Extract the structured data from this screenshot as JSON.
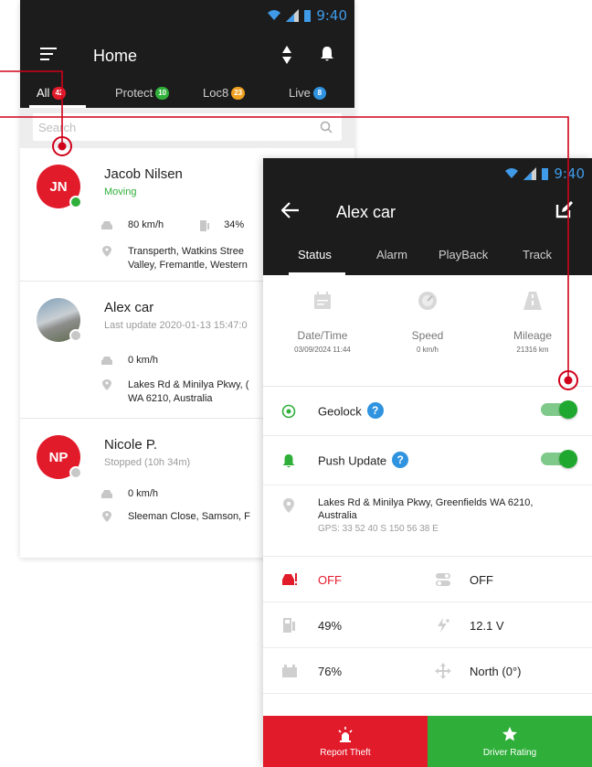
{
  "colors": {
    "dark_bar": "#1c1c1c",
    "accent_red": "#e21b2b",
    "accent_green": "#2faf3a",
    "accent_blue": "#2f93e0",
    "time_blue": "#3f9be8"
  },
  "home": {
    "status_time": "9:40",
    "title": "Home",
    "tabs": [
      {
        "label": "All",
        "badge": "42",
        "badge_color": "#e21b2b"
      },
      {
        "label": "Protect",
        "badge": "10",
        "badge_color": "#2faf3a"
      },
      {
        "label": "Loc8",
        "badge": "23",
        "badge_color": "#f0a020"
      },
      {
        "label": "Live",
        "badge": "8",
        "badge_color": "#2f93e0"
      }
    ],
    "search_placeholder": "Search",
    "vehicles": [
      {
        "initials": "JN",
        "name": "Jacob Nilsen",
        "state": "Moving",
        "state_color": "#2faf3a",
        "speed": "80 km/h",
        "fuel": "34%",
        "address_line1": "Transperth, Watkins Stree",
        "address_line2": "Valley, Fremantle, Western"
      },
      {
        "initials": "",
        "name": "Alex car",
        "state": "Last update 2020-01-13 15:47:0",
        "state_color": "#9a9a9a",
        "speed": "0 km/h",
        "address_line1": "Lakes Rd & Minilya Pkwy, (",
        "address_line2": "WA 6210, Australia"
      },
      {
        "initials": "NP",
        "name": "Nicole P.",
        "state": "Stopped (10h 34m)",
        "state_color": "#9a9a9a",
        "speed": "0 km/h",
        "address_line1": "Sleeman Close, Samson, F"
      }
    ]
  },
  "detail": {
    "status_time": "9:40",
    "title": "Alex car",
    "tabs": [
      "Status",
      "Alarm",
      "PlayBack",
      "Track"
    ],
    "stats": [
      {
        "label": "Date/Time",
        "value": "03/09/2024 11:44"
      },
      {
        "label": "Speed",
        "value": "0 km/h"
      },
      {
        "label": "Mileage",
        "value": "21316 km"
      }
    ],
    "toggles": [
      {
        "label": "Geolock",
        "on": true
      },
      {
        "label": "Push Update",
        "on": true
      }
    ],
    "help_glyph": "?",
    "location": {
      "address": "Lakes Rd & Minilya Pkwy, Greenfields WA 6210, Australia",
      "gps": "GPS: 33 52 40 S 150 56 38 E"
    },
    "grid": [
      {
        "left": "OFF",
        "right": "OFF"
      },
      {
        "left": "49%",
        "right": "12.1 V"
      },
      {
        "left": "76%",
        "right": "North (0°)"
      }
    ],
    "bottom": {
      "theft_label": "Report Theft",
      "rating_label": "Driver Rating"
    }
  }
}
